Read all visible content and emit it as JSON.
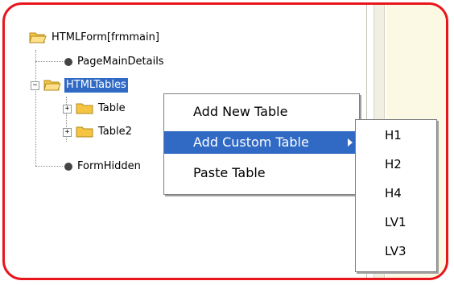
{
  "tree": {
    "root": "HTMLForm[frmmain]",
    "items": [
      {
        "label": "PageMainDetails"
      },
      {
        "label": "HTMLTables"
      },
      {
        "label": "Table"
      },
      {
        "label": "Table2"
      },
      {
        "label": "FormHidden"
      }
    ]
  },
  "context_menu": {
    "items": [
      "Add New Table",
      "Add Custom Table",
      "Paste Table"
    ]
  },
  "submenu": {
    "items": [
      "H1",
      "H2",
      "H4",
      "LV1",
      "LV3"
    ]
  },
  "colors": {
    "highlight": "#316ac5",
    "frame_border": "#e8161b",
    "folder": "#f5c542"
  }
}
